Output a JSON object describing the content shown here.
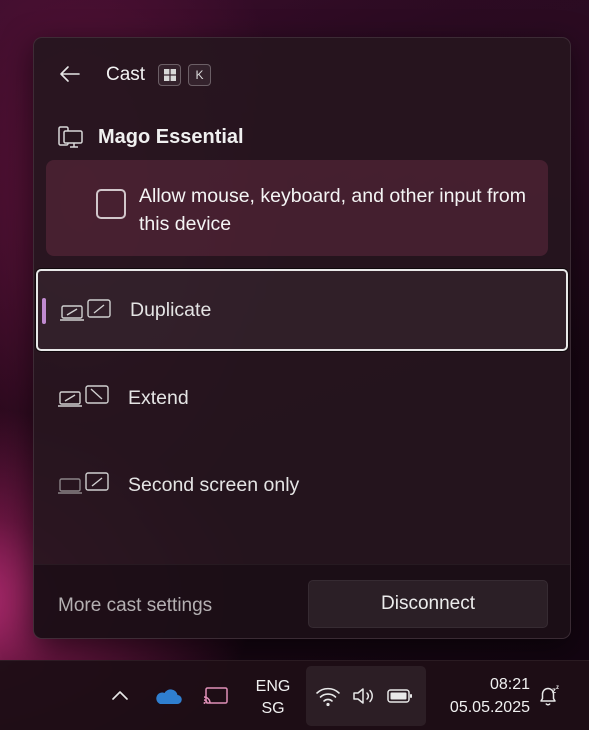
{
  "flyout": {
    "title": "Cast",
    "shortcut_keys": [
      "⊞",
      "K"
    ],
    "device_name": "Mago Essential",
    "allow_input_label": "Allow mouse, keyboard, and other input from this device",
    "allow_input_checked": false,
    "modes": [
      {
        "label": "Duplicate",
        "icon": "duplicate-display-icon",
        "selected": true
      },
      {
        "label": "Extend",
        "icon": "extend-display-icon",
        "selected": false
      },
      {
        "label": "Second screen only",
        "icon": "second-screen-only-icon",
        "selected": false
      }
    ],
    "more_settings_label": "More cast settings",
    "disconnect_label": "Disconnect"
  },
  "taskbar": {
    "icons": [
      "chevron-up-icon",
      "onedrive-icon",
      "cast-icon",
      "wifi-icon",
      "volume-icon",
      "battery-icon",
      "notification-bell-icon"
    ],
    "language_line1": "ENG",
    "language_line2": "SG",
    "time": "08:21",
    "date": "05.05.2025"
  },
  "colors": {
    "selection_indicator": "#c08ad0",
    "onedrive": "#2f7fd0",
    "panel_bg": "#26161e"
  }
}
